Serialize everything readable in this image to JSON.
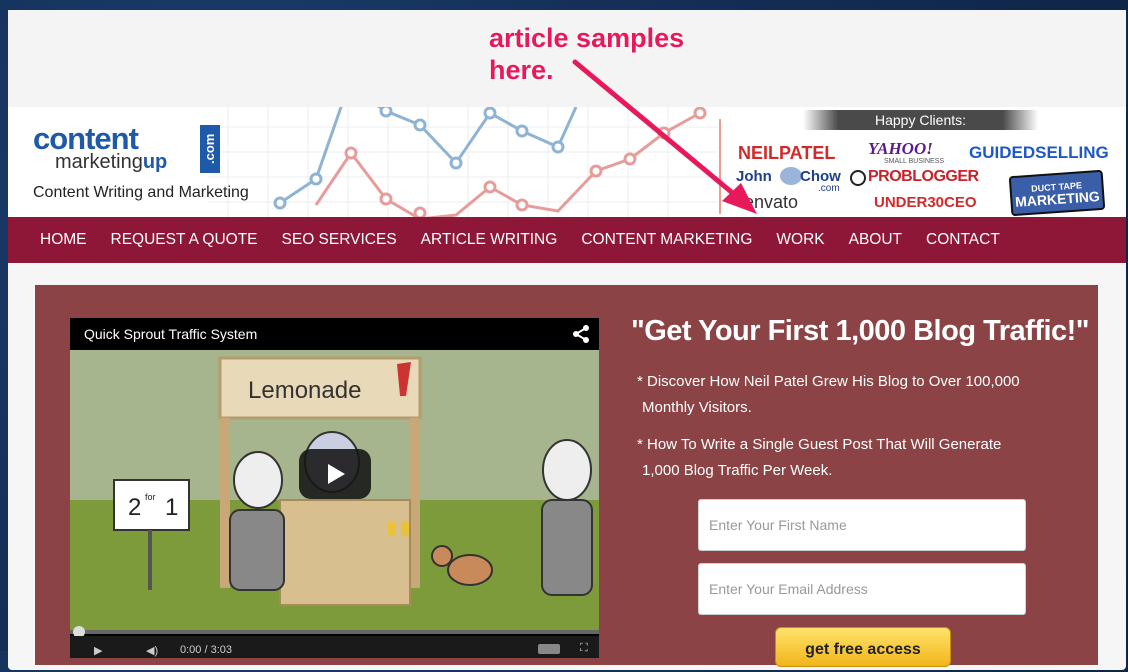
{
  "annotation": {
    "line1": "article samples",
    "line2": "here."
  },
  "logo": {
    "word1": "content",
    "word2a": "marketing",
    "word2b": "up",
    "tld": ".com"
  },
  "tagline": "Content Writing and Marketing",
  "clients": {
    "title": "Happy Clients:",
    "names": [
      "NEILPATEL",
      "YAHOO!",
      "SMALL BUSINESS",
      "GUIDEDSELLING",
      "John",
      "Chow",
      ".com",
      "PROBLOGGER",
      "envato",
      "UNDER30CEO",
      "DUCT TAPE",
      "MARKETING"
    ]
  },
  "nav": [
    "HOME",
    "REQUEST A QUOTE",
    "SEO SERVICES",
    "ARTICLE WRITING",
    "CONTENT MARKETING",
    "WORK",
    "ABOUT",
    "CONTACT"
  ],
  "video": {
    "title": "Quick Sprout Traffic System",
    "sign_lemonade": "Lemonade",
    "sign_offer_big": "2",
    "sign_offer_small": "for",
    "sign_offer_end": "1",
    "time": "0:00 / 3:03"
  },
  "offer": {
    "headline": "\"Get Your First 1,000 Blog Traffic!\"",
    "bullet1_line1": "* Discover How Neil Patel Grew His Blog to Over 100,000",
    "bullet1_line2": "Monthly Visitors.",
    "bullet2_line1": "* How To Write a Single Guest Post That Will Generate",
    "bullet2_line2": "1,000 Blog Traffic Per Week.",
    "first_name_placeholder": "Enter Your First Name",
    "email_placeholder": "Enter Your Email Address",
    "cta_label": "get free access"
  },
  "colors": {
    "nav_bg": "#8e1636",
    "panel_bg": "#8b4345",
    "annotation": "#e8195a",
    "logo_blue": "#1f5aa8"
  }
}
